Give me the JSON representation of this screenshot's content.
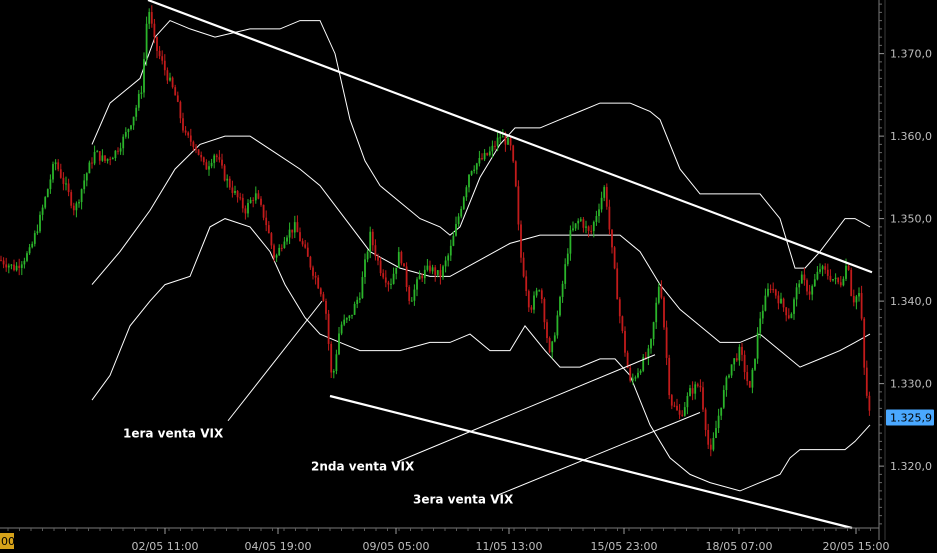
{
  "chart_data": {
    "type": "candlestick",
    "title": "",
    "y_axis": {
      "side": "right",
      "ticks": [
        1320.0,
        1330.0,
        1340.0,
        1350.0,
        1360.0,
        1370.0
      ],
      "tick_labels": [
        "1.320,0",
        "1.330,0",
        "1.340,0",
        "1.350,0",
        "1.360,0",
        "1.370,0"
      ],
      "ylim": [
        1312.5,
        1376.5
      ]
    },
    "x_axis": {
      "tick_labels": [
        "02/05 11:00",
        "04/05 19:00",
        "09/05 05:00",
        "11/05 13:00",
        "15/05 23:00",
        "18/05 07:00",
        "20/05 15:00"
      ],
      "xlim": [
        0,
        872
      ]
    },
    "last_price": {
      "value": 1325.9,
      "label": "1.325,9",
      "color": "#4aa8ff"
    },
    "left_edge_label": "00",
    "grid": false,
    "colors": {
      "up": "#2bb52b",
      "down": "#c21b1b",
      "bands": "#ffffff",
      "trendlines": "#ffffff"
    },
    "price_path": [
      [
        0,
        1345
      ],
      [
        15,
        1344
      ],
      [
        30,
        1346
      ],
      [
        40,
        1350
      ],
      [
        55,
        1357
      ],
      [
        65,
        1354
      ],
      [
        75,
        1351
      ],
      [
        85,
        1355
      ],
      [
        95,
        1358
      ],
      [
        105,
        1357
      ],
      [
        115,
        1358
      ],
      [
        125,
        1360
      ],
      [
        135,
        1363
      ],
      [
        142,
        1366
      ],
      [
        148,
        1376
      ],
      [
        155,
        1371
      ],
      [
        165,
        1368
      ],
      [
        175,
        1365
      ],
      [
        185,
        1360
      ],
      [
        195,
        1359
      ],
      [
        205,
        1356
      ],
      [
        215,
        1358
      ],
      [
        225,
        1355
      ],
      [
        235,
        1353
      ],
      [
        245,
        1351
      ],
      [
        255,
        1353
      ],
      [
        265,
        1350
      ],
      [
        275,
        1345
      ],
      [
        285,
        1348
      ],
      [
        295,
        1349
      ],
      [
        305,
        1346
      ],
      [
        315,
        1343
      ],
      [
        325,
        1340
      ],
      [
        332,
        1330
      ],
      [
        340,
        1337
      ],
      [
        350,
        1338
      ],
      [
        360,
        1341
      ],
      [
        370,
        1348
      ],
      [
        380,
        1344
      ],
      [
        390,
        1342
      ],
      [
        400,
        1346
      ],
      [
        410,
        1340
      ],
      [
        420,
        1343
      ],
      [
        430,
        1344
      ],
      [
        440,
        1343
      ],
      [
        450,
        1346
      ],
      [
        460,
        1351
      ],
      [
        470,
        1356
      ],
      [
        480,
        1357
      ],
      [
        490,
        1358
      ],
      [
        500,
        1360
      ],
      [
        510,
        1359
      ],
      [
        515,
        1355
      ],
      [
        520,
        1346
      ],
      [
        530,
        1339
      ],
      [
        540,
        1342
      ],
      [
        550,
        1333
      ],
      [
        560,
        1340
      ],
      [
        570,
        1348
      ],
      [
        580,
        1350
      ],
      [
        590,
        1348
      ],
      [
        600,
        1352
      ],
      [
        605,
        1354
      ],
      [
        610,
        1348
      ],
      [
        620,
        1338
      ],
      [
        630,
        1330
      ],
      [
        640,
        1332
      ],
      [
        650,
        1334
      ],
      [
        660,
        1343
      ],
      [
        670,
        1328
      ],
      [
        680,
        1326
      ],
      [
        690,
        1329
      ],
      [
        700,
        1330
      ],
      [
        710,
        1321
      ],
      [
        720,
        1327
      ],
      [
        730,
        1332
      ],
      [
        740,
        1334
      ],
      [
        750,
        1329
      ],
      [
        760,
        1338
      ],
      [
        770,
        1342
      ],
      [
        780,
        1340
      ],
      [
        790,
        1338
      ],
      [
        800,
        1343
      ],
      [
        810,
        1341
      ],
      [
        820,
        1344
      ],
      [
        830,
        1343
      ],
      [
        840,
        1342
      ],
      [
        848,
        1345
      ],
      [
        852,
        1340
      ],
      [
        860,
        1341
      ],
      [
        865,
        1330
      ],
      [
        870,
        1326
      ]
    ],
    "bollinger_upper": [
      [
        92,
        1359
      ],
      [
        110,
        1364
      ],
      [
        140,
        1367
      ],
      [
        155,
        1372
      ],
      [
        170,
        1374
      ],
      [
        190,
        1373
      ],
      [
        215,
        1372
      ],
      [
        250,
        1373
      ],
      [
        280,
        1373
      ],
      [
        300,
        1374
      ],
      [
        320,
        1374
      ],
      [
        335,
        1370
      ],
      [
        350,
        1362
      ],
      [
        365,
        1357
      ],
      [
        380,
        1354
      ],
      [
        400,
        1352
      ],
      [
        420,
        1350
      ],
      [
        440,
        1349
      ],
      [
        450,
        1348
      ],
      [
        460,
        1349
      ],
      [
        480,
        1355
      ],
      [
        500,
        1359
      ],
      [
        515,
        1361
      ],
      [
        540,
        1361
      ],
      [
        560,
        1362
      ],
      [
        580,
        1363
      ],
      [
        600,
        1364
      ],
      [
        630,
        1364
      ],
      [
        650,
        1363
      ],
      [
        660,
        1362
      ],
      [
        680,
        1356
      ],
      [
        700,
        1353
      ],
      [
        720,
        1353
      ],
      [
        740,
        1353
      ],
      [
        760,
        1353
      ],
      [
        780,
        1350
      ],
      [
        795,
        1344
      ],
      [
        805,
        1344
      ],
      [
        820,
        1346
      ],
      [
        845,
        1350
      ],
      [
        855,
        1350
      ],
      [
        870,
        1349
      ]
    ],
    "bollinger_middle": [
      [
        92,
        1342
      ],
      [
        120,
        1346
      ],
      [
        150,
        1351
      ],
      [
        175,
        1356
      ],
      [
        200,
        1359
      ],
      [
        225,
        1360
      ],
      [
        250,
        1360
      ],
      [
        275,
        1358
      ],
      [
        300,
        1356
      ],
      [
        320,
        1354
      ],
      [
        345,
        1350
      ],
      [
        370,
        1346
      ],
      [
        400,
        1344
      ],
      [
        430,
        1343
      ],
      [
        450,
        1343
      ],
      [
        480,
        1345
      ],
      [
        510,
        1347
      ],
      [
        540,
        1348
      ],
      [
        570,
        1348
      ],
      [
        600,
        1348
      ],
      [
        620,
        1348
      ],
      [
        640,
        1346
      ],
      [
        660,
        1342
      ],
      [
        680,
        1339
      ],
      [
        700,
        1337
      ],
      [
        720,
        1335
      ],
      [
        740,
        1335
      ],
      [
        760,
        1336
      ],
      [
        780,
        1334
      ],
      [
        800,
        1332
      ],
      [
        820,
        1333
      ],
      [
        840,
        1334
      ],
      [
        855,
        1335
      ],
      [
        870,
        1336
      ]
    ],
    "bollinger_lower": [
      [
        92,
        1328
      ],
      [
        110,
        1331
      ],
      [
        130,
        1337
      ],
      [
        150,
        1340
      ],
      [
        165,
        1342
      ],
      [
        190,
        1343
      ],
      [
        210,
        1349
      ],
      [
        225,
        1350
      ],
      [
        250,
        1349
      ],
      [
        270,
        1346
      ],
      [
        285,
        1342
      ],
      [
        305,
        1338
      ],
      [
        320,
        1336
      ],
      [
        340,
        1335
      ],
      [
        360,
        1334
      ],
      [
        380,
        1334
      ],
      [
        400,
        1334
      ],
      [
        430,
        1335
      ],
      [
        450,
        1335
      ],
      [
        470,
        1336
      ],
      [
        490,
        1334
      ],
      [
        510,
        1334
      ],
      [
        525,
        1337
      ],
      [
        545,
        1334
      ],
      [
        560,
        1332
      ],
      [
        580,
        1332
      ],
      [
        600,
        1333
      ],
      [
        615,
        1333
      ],
      [
        630,
        1331
      ],
      [
        650,
        1325
      ],
      [
        670,
        1321
      ],
      [
        690,
        1319
      ],
      [
        710,
        1318
      ],
      [
        740,
        1317
      ],
      [
        760,
        1318
      ],
      [
        780,
        1319
      ],
      [
        790,
        1321
      ],
      [
        800,
        1322
      ],
      [
        820,
        1322
      ],
      [
        845,
        1322
      ],
      [
        855,
        1323
      ],
      [
        870,
        1325
      ]
    ],
    "trendlines": [
      {
        "name": "resistance",
        "from": [
          148,
          1376.5
        ],
        "to": [
          872,
          1343.5
        ]
      },
      {
        "name": "support",
        "from": [
          330,
          1328.5
        ],
        "to": [
          852,
          1312.5
        ]
      }
    ],
    "annotations": [
      {
        "text": "1era venta VIX",
        "at": [
          123,
          1323.5
        ],
        "arrow_from": [
          228,
          1325.5
        ],
        "arrow_to": [
          322,
          1340.0
        ]
      },
      {
        "text": "2nda venta VIX",
        "at": [
          311,
          1319.5
        ],
        "arrow_from": [
          397,
          1320.5
        ],
        "arrow_to": [
          655,
          1333.5
        ]
      },
      {
        "text": "3era venta VIX",
        "at": [
          413,
          1315.5
        ],
        "arrow_from": [
          498,
          1316.5
        ],
        "arrow_to": [
          700,
          1326.5
        ]
      }
    ]
  }
}
